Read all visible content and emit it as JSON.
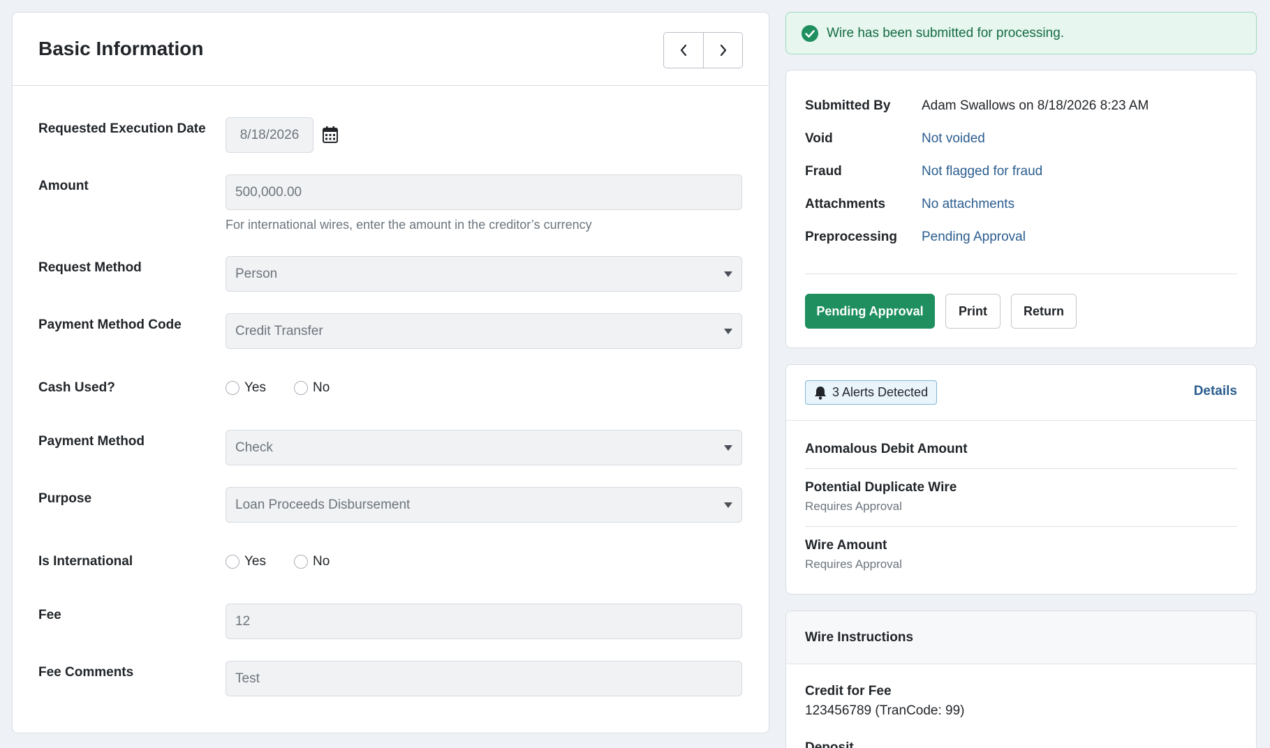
{
  "basic_info": {
    "title": "Basic Information",
    "fields": {
      "execution_date": {
        "label": "Requested Execution Date",
        "value": "8/18/2026"
      },
      "amount": {
        "label": "Amount",
        "value": "500,000.00",
        "help": "For international wires, enter the amount in the creditor’s currency"
      },
      "request_method": {
        "label": "Request Method",
        "value": "Person"
      },
      "payment_method_code": {
        "label": "Payment Method Code",
        "value": "Credit Transfer"
      },
      "cash_used": {
        "label": "Cash Used?",
        "options": [
          "Yes",
          "No"
        ]
      },
      "payment_method": {
        "label": "Payment Method",
        "value": "Check"
      },
      "purpose": {
        "label": "Purpose",
        "value": "Loan Proceeds Disbursement"
      },
      "is_international": {
        "label": "Is International",
        "options": [
          "Yes",
          "No"
        ]
      },
      "fee": {
        "label": "Fee",
        "value": "12"
      },
      "fee_comments": {
        "label": "Fee Comments",
        "value": "Test"
      }
    }
  },
  "status_alert": {
    "message": "Wire has been submitted for processing."
  },
  "summary": {
    "submitted_by": {
      "label": "Submitted By",
      "value": "Adam Swallows on 8/18/2026 8:23 AM"
    },
    "void": {
      "label": "Void",
      "value": "Not voided"
    },
    "fraud": {
      "label": "Fraud",
      "value": "Not flagged for fraud"
    },
    "attachments": {
      "label": "Attachments",
      "value": "No attachments"
    },
    "preprocessing": {
      "label": "Preprocessing",
      "value": "Pending Approval"
    },
    "buttons": {
      "pending": "Pending Approval",
      "print": "Print",
      "return": "Return"
    }
  },
  "alerts": {
    "badge": "3 Alerts Detected",
    "details_link": "Details",
    "items": [
      {
        "title": "Anomalous Debit Amount"
      },
      {
        "title": "Potential Duplicate Wire",
        "sub": "Requires Approval"
      },
      {
        "title": "Wire Amount",
        "sub": "Requires Approval"
      }
    ]
  },
  "wire_instructions": {
    "title": "Wire Instructions",
    "items": [
      {
        "title": "Credit for Fee",
        "value": "123456789 (TranCode: 99)"
      }
    ],
    "partial_next": "Deposit"
  },
  "colors": {
    "primary": "#1f8f5f",
    "link": "#2b5d8f",
    "success_bg": "#e7f6ef"
  }
}
